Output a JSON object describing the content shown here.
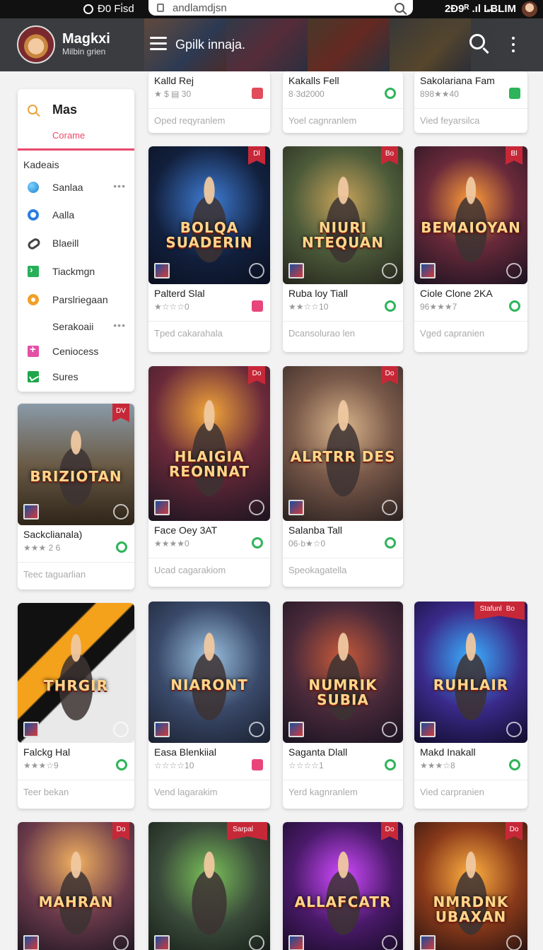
{
  "status": {
    "time": "Đ0 Fi̇sd",
    "right": "2Ɖ9ᴿ .ıl L̶BLIM"
  },
  "url": {
    "text": "andlamdjsn"
  },
  "brand": {
    "name": "Magkxi",
    "subtitle": "Milbin grien"
  },
  "header": {
    "title": "Gpilk innaja."
  },
  "sidebar": {
    "search_value": "Mas",
    "search_hint": "Corame",
    "heading": "Kadeais",
    "items": [
      {
        "label": "Sanlaa",
        "icon": "globe-icon",
        "more": "•••"
      },
      {
        "label": "Aalla",
        "icon": "ring-icon"
      },
      {
        "label": "Blaeill",
        "icon": "link-icon"
      },
      {
        "label": "Tiackmgn",
        "icon": "terminal-icon"
      },
      {
        "label": "Parslriegaan",
        "icon": "cog-icon"
      },
      {
        "label": "Serakoaii",
        "icon": "",
        "more": "•••"
      },
      {
        "label": "Ceniocess",
        "icon": "plus-icon"
      },
      {
        "label": "Sures",
        "icon": "chart-icon"
      }
    ]
  },
  "games": [
    {
      "title": "Kalld Rej",
      "meta": "★ $ ▤ 30",
      "footer": "Oped reqyranlem",
      "status": "red",
      "art": ""
    },
    {
      "title": "Kakalls Fell",
      "meta": "8·3d2000",
      "footer": "Yoel cagnranlem",
      "status": "green",
      "art": ""
    },
    {
      "title": "Sakolariana Fam",
      "meta": "898★★40",
      "footer": "Vied feyarsilca",
      "status": "gift",
      "art": ""
    },
    {
      "title": "Palterd Slal",
      "meta": "★☆☆☆0",
      "footer": "Tped cakarahala",
      "status": "pink",
      "art": "BOLQA SUADERIN",
      "ribbon": "Dl"
    },
    {
      "title": "Ruba loy Tiall",
      "meta": "★★☆☆10",
      "footer": "Dcansolurao len",
      "status": "green",
      "art": "NIURI NTEQUAN",
      "ribbon": "Bo"
    },
    {
      "title": "Ciole Clone 2KA",
      "meta": "96★★★7",
      "footer": "Vged capranien",
      "status": "green",
      "art": "BEMAIOYAN",
      "ribbon": "Bl"
    },
    {
      "title": "Sackclianala)",
      "meta": "★★★ 2 6",
      "footer": "Teec taguarlian",
      "status": "green",
      "art": "BRIZIOTAN",
      "ribbon": "DV"
    },
    {
      "title": "Face Oey 3AT",
      "meta": "★★★★0",
      "footer": "Ucad cagarakiom",
      "status": "green",
      "art": "HLAIGIA REONNAT",
      "ribbon": "Do"
    },
    {
      "title": "Salanba Tall",
      "meta": "06·b★☆0",
      "footer": "Speokagatella",
      "status": "green",
      "art": "ALRTRR DES",
      "ribbon": "Do"
    },
    {
      "title": "Falckg Hal",
      "meta": "★★★☆9",
      "footer": "Teer bekan",
      "status": "green",
      "art": "THRGIR",
      "ribbon": ""
    },
    {
      "title": "Easa Blenkiial",
      "meta": "☆☆☆☆10",
      "footer": "Vend lagarakim",
      "status": "pink",
      "art": "NIARONT",
      "ribbon": ""
    },
    {
      "title": "Saganta Dlall",
      "meta": "☆☆☆☆1",
      "footer": "Yerd kagnranlem",
      "status": "green",
      "art": "NUMRIK SUBIA",
      "ribbon": ""
    },
    {
      "title": "Makd Inakall",
      "meta": "★★★☆8",
      "footer": "Vied carpranien",
      "status": "green",
      "art": "RUHLAIR",
      "ribbon": "Bo",
      "ribbon_text": "Stafunl"
    },
    {
      "title": "",
      "meta": "",
      "footer": "",
      "status": "",
      "art": "MAHRAN",
      "ribbon": "Do"
    },
    {
      "title": "",
      "meta": "",
      "footer": "",
      "status": "",
      "art": "",
      "ribbon": "",
      "ribbon_text": "Sarpal"
    },
    {
      "title": "",
      "meta": "",
      "footer": "",
      "status": "",
      "art": "ALLAFCATR",
      "ribbon": "Do"
    },
    {
      "title": "",
      "meta": "",
      "footer": "",
      "status": "",
      "art": "NMRDNK UBAXAN",
      "ribbon": "Do"
    }
  ]
}
